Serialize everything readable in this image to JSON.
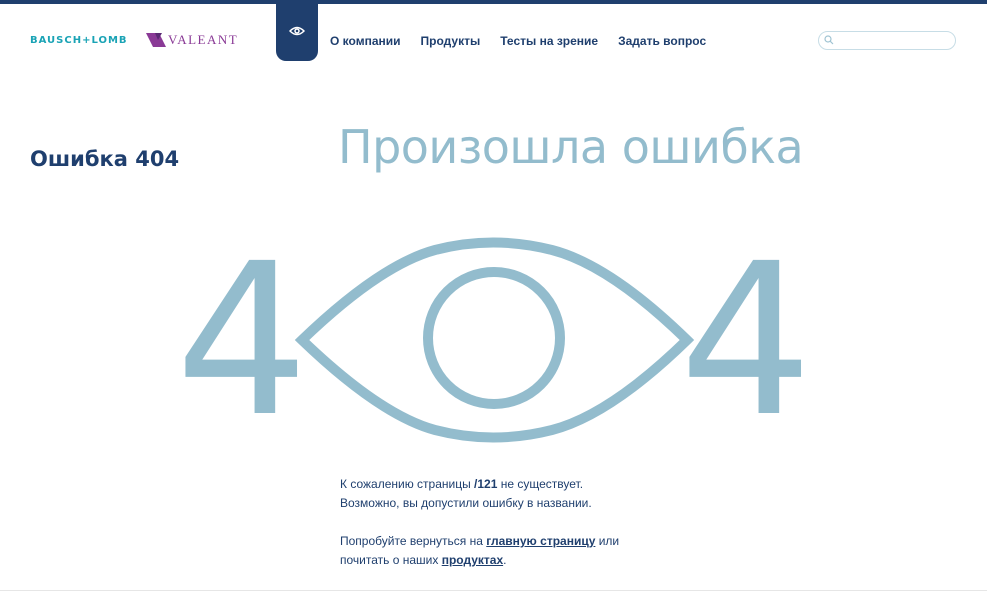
{
  "header": {
    "brand_logo": "BAUSCH+LOMB",
    "partner_logo": "VALEANT",
    "nav": [
      {
        "label": "О компании"
      },
      {
        "label": "Продукты"
      },
      {
        "label": "Тесты на зрение"
      },
      {
        "label": "Задать вопрос"
      }
    ],
    "search": {
      "value": "",
      "placeholder": ""
    }
  },
  "page": {
    "side_title": "Ошибка 404",
    "title": "Произошла ошибка",
    "big_digit_left": "4",
    "big_digit_right": "4"
  },
  "message": {
    "line1_prefix": "К сожалению страницы ",
    "line1_path": "/121",
    "line1_suffix": " не существует.",
    "line2": "Возможно, вы допустили ошибку в названии.",
    "line3_prefix": "Попробуйте вернуться на ",
    "home_link": "главную страницу",
    "line3_suffix": " или",
    "line4_prefix": "почитать о наших ",
    "products_link": "продуктах",
    "line4_suffix": "."
  },
  "colors": {
    "primary_navy": "#1f3f6e",
    "accent_light_blue": "#93bccd",
    "brand_teal": "#1aa3b5",
    "partner_purple": "#8a3a96"
  },
  "icons": {
    "nav_tab": "eye-icon",
    "search": "search-icon"
  }
}
